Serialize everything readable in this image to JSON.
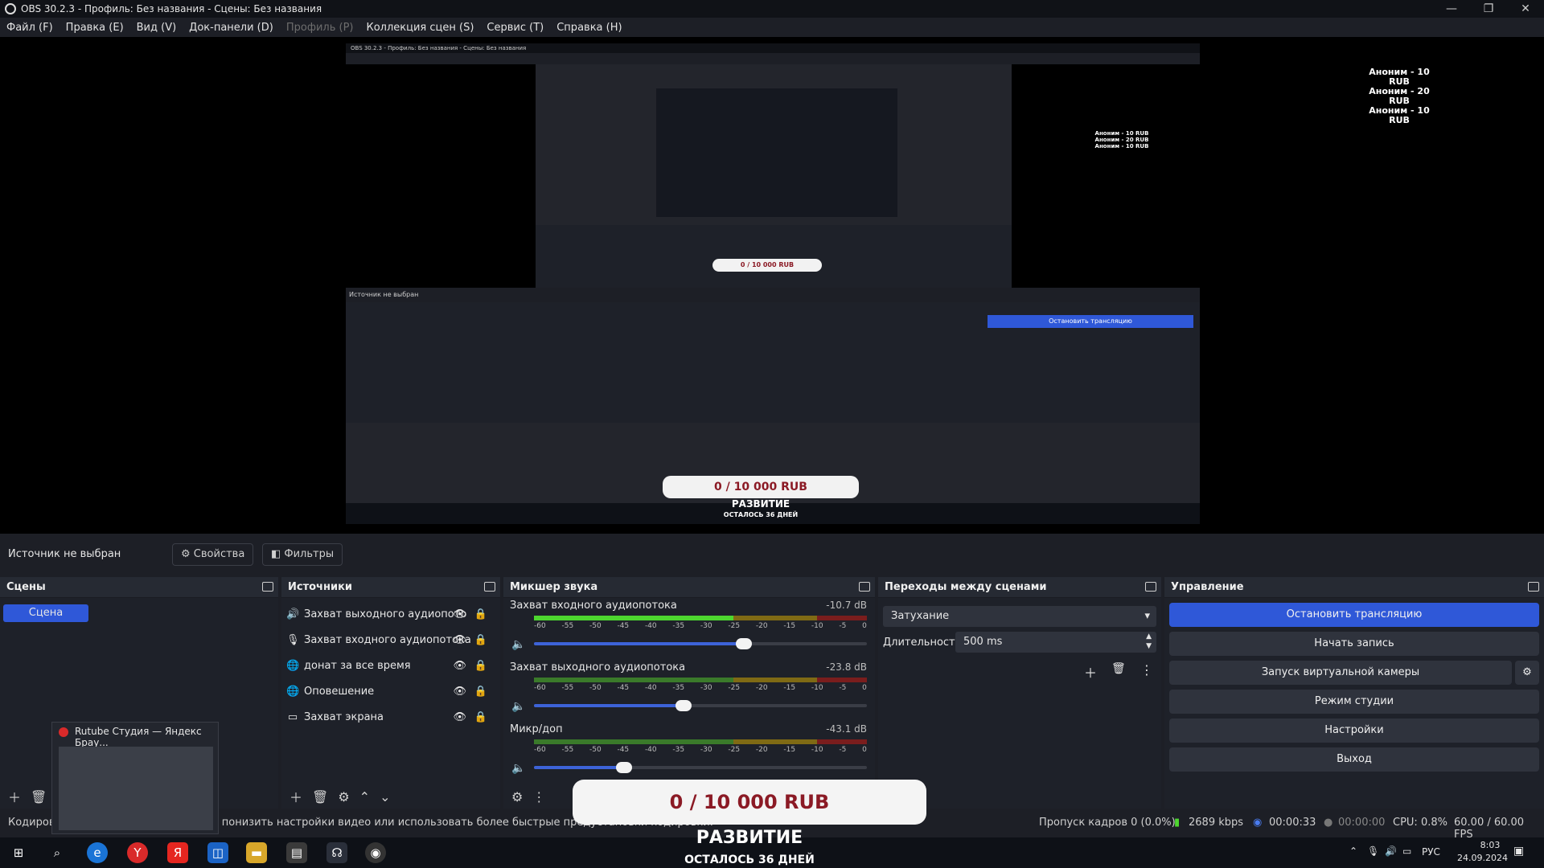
{
  "window": {
    "title": "OBS 30.2.3 - Профиль: Без названия - Сцены: Без названия",
    "minimize": "—",
    "maximize": "❐",
    "close": "✕"
  },
  "menu": [
    "Файл (F)",
    "Правка (E)",
    "Вид (V)",
    "Док-панели (D)",
    "Профиль (P)",
    "Коллекция сцен (S)",
    "Сервис (T)",
    "Справка (H)"
  ],
  "preview": {
    "nested_title": "OBS 30.2.3 - Профиль: Без названия - Сцены: Без названия",
    "donations": [
      "Аноним - 10 RUB",
      "Аноним - 20 RUB",
      "Аноним - 10 RUB"
    ],
    "goal_value": "0 / 10 000 RUB",
    "goal_title": "РАЗВИТИЕ",
    "goal_remaining": "ОСТАЛОСЬ 36 ДНЕЙ"
  },
  "source_bar": {
    "no_source": "Источник не выбран",
    "properties": "Свойства",
    "filters": "Фильтры"
  },
  "scenes": {
    "title": "Сцены",
    "items": [
      "Сцена"
    ]
  },
  "sources": {
    "title": "Источники",
    "items": [
      {
        "icon": "speaker-icon",
        "label": "Захват выходного аудиопото"
      },
      {
        "icon": "mic-icon",
        "label": "Захват входного аудиопотока"
      },
      {
        "icon": "browser-icon",
        "label": "донат за все время"
      },
      {
        "icon": "browser-icon",
        "label": "Оповешение"
      },
      {
        "icon": "monitor-icon",
        "label": "Захват экрана"
      }
    ]
  },
  "mixer": {
    "title": "Микшер звука",
    "ticks": [
      "-60",
      "-55",
      "-50",
      "-45",
      "-40",
      "-35",
      "-30",
      "-25",
      "-20",
      "-15",
      "-10",
      "-5",
      "0"
    ],
    "channels": [
      {
        "name": "Захват входного аудиопотока",
        "db": "-10.7 dB",
        "level": 0.6,
        "volume": 0.63
      },
      {
        "name": "Захват выходного аудиопотока",
        "db": "-23.8 dB",
        "level": 0.0,
        "volume": 0.45
      },
      {
        "name": "Микр/доп",
        "db": "-43.1 dB",
        "level": 0.0,
        "volume": 0.27
      }
    ]
  },
  "transitions": {
    "title": "Переходы между сценами",
    "selected": "Затухание",
    "duration_label": "Длительность",
    "duration_value": "500 ms"
  },
  "controls": {
    "title": "Управление",
    "buttons": [
      "Остановить трансляцию",
      "Начать запись",
      "Запуск виртуальной камеры",
      "Режим студии",
      "Настройки",
      "Выход"
    ]
  },
  "status": {
    "message": "Кодировка перегружена! Попробуйте понизить настройки видео или использовать более быстрые предустановки кодировки.",
    "dropped": "Пропуск кадров 0 (0.0%)",
    "bitrate": "2689 kbps",
    "stream_time": "00:00:33",
    "rec_time": "00:00:00",
    "cpu": "CPU: 0.8%",
    "fps": "60.00 / 60.00 FPS"
  },
  "thumbnail": {
    "title": "Rutube Студия — Яндекс Брау..."
  },
  "taskbar": {
    "lang": "РУС",
    "time": "8:03",
    "date": "24.09.2024"
  },
  "colors": {
    "accent": "#2f58d8",
    "goal_text": "#8b1a25"
  }
}
